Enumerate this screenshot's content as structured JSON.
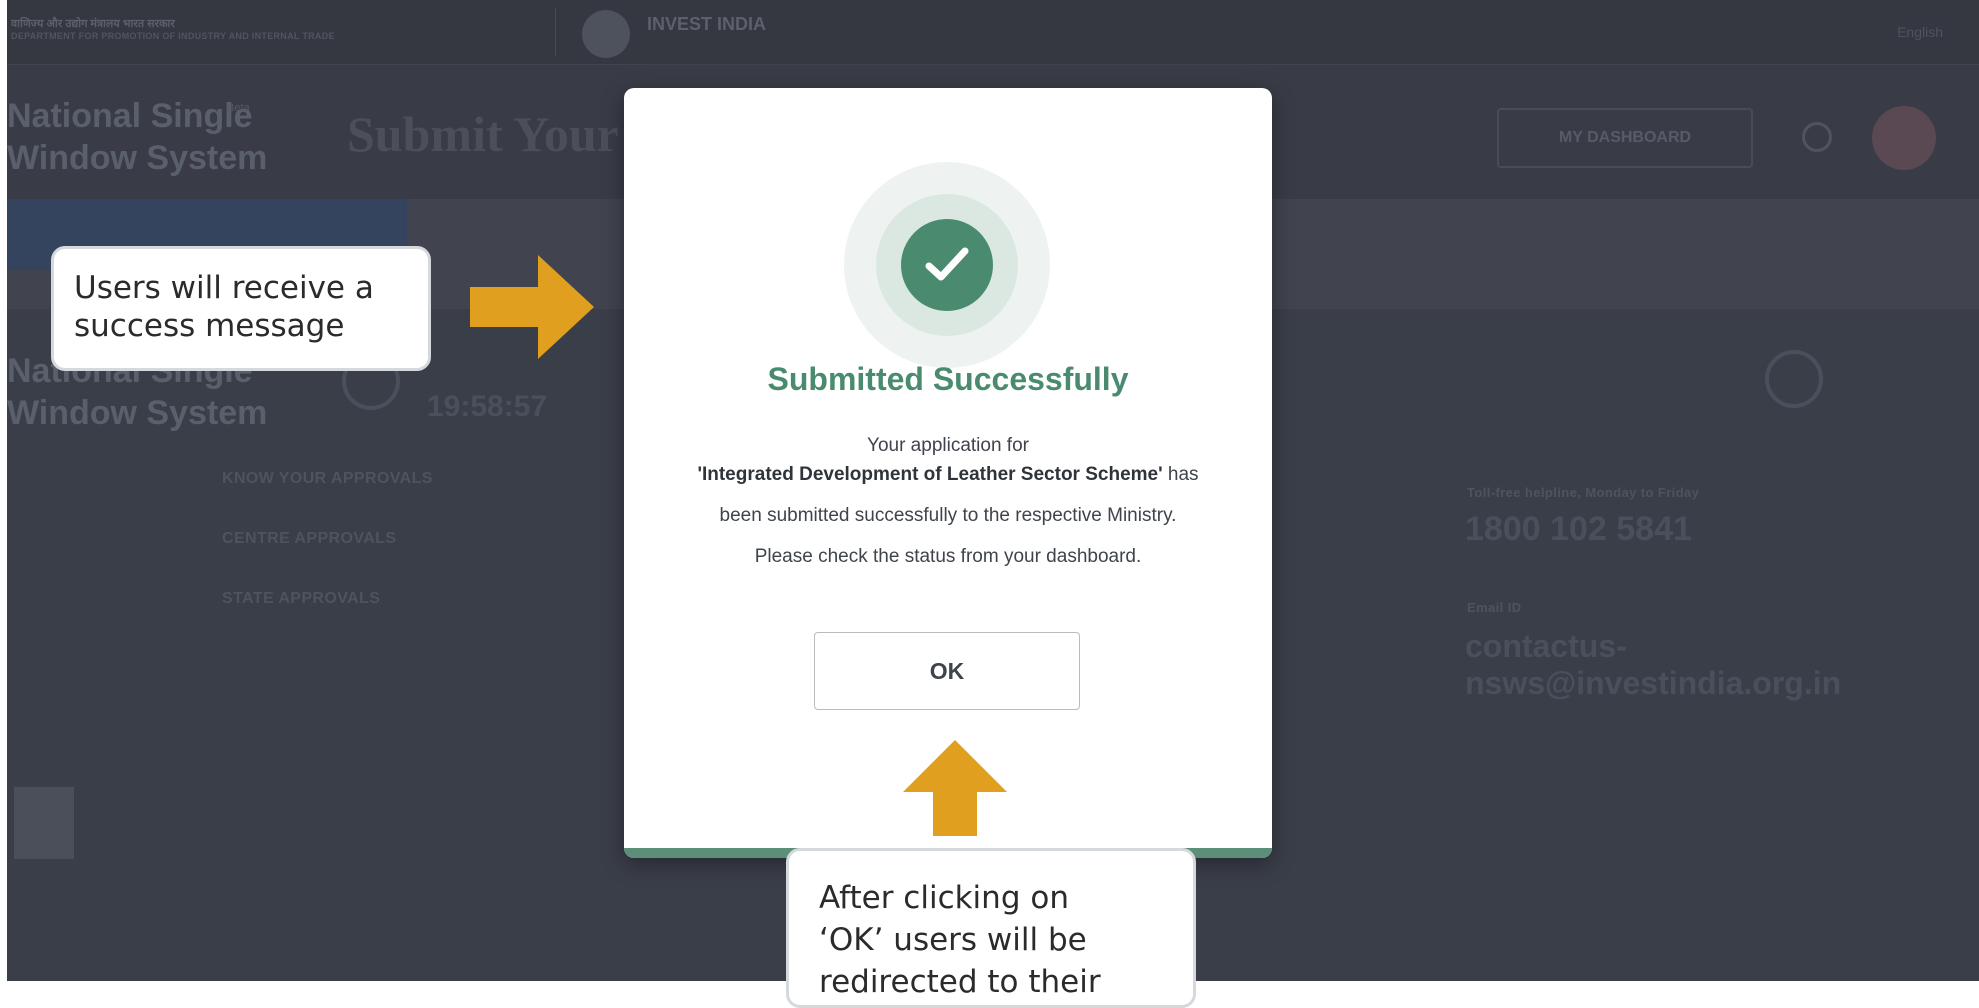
{
  "background": {
    "gov_line1": "वाणिज्य और उद्योग मंत्रालय भारत सरकार",
    "gov_line2": "DEPARTMENT FOR PROMOTION OF INDUSTRY AND INTERNAL TRADE",
    "invest_brand": "INVEST INDIA",
    "language": "English",
    "app_name_line1": "National Single",
    "app_name_line2": "Window System",
    "beta": "Beta",
    "page_title": "Submit Your",
    "dashboard_button": "MY DASHBOARD",
    "footer": {
      "time": "19:58:57",
      "links": [
        "KNOW YOUR APPROVALS",
        "CENTRE APPROVALS",
        "STATE APPROVALS"
      ],
      "helpline_label": "Toll-free helpline, Monday to Friday",
      "helpline_number": "1800 102 5841",
      "email_label": "Email ID",
      "email": "contactus-nsws@investindia.org.in"
    }
  },
  "modal": {
    "title": "Submitted Successfully",
    "line1": "Your application for",
    "scheme_name": "'Integrated Development of Leather Sector Scheme'",
    "line2_suffix": " has",
    "line3": "been submitted successfully to the respective Ministry.",
    "line4": "Please check the status from your dashboard.",
    "ok_label": "OK",
    "colors": {
      "accent": "#4a8b6f"
    }
  },
  "callouts": {
    "left": [
      "Users will receive a",
      "success message"
    ],
    "bottom": [
      "After clicking on",
      "‘OK’ users will be",
      "redirected to their"
    ]
  },
  "colors": {
    "arrow": "#e09f1f",
    "overlay": "#3a3e48"
  }
}
